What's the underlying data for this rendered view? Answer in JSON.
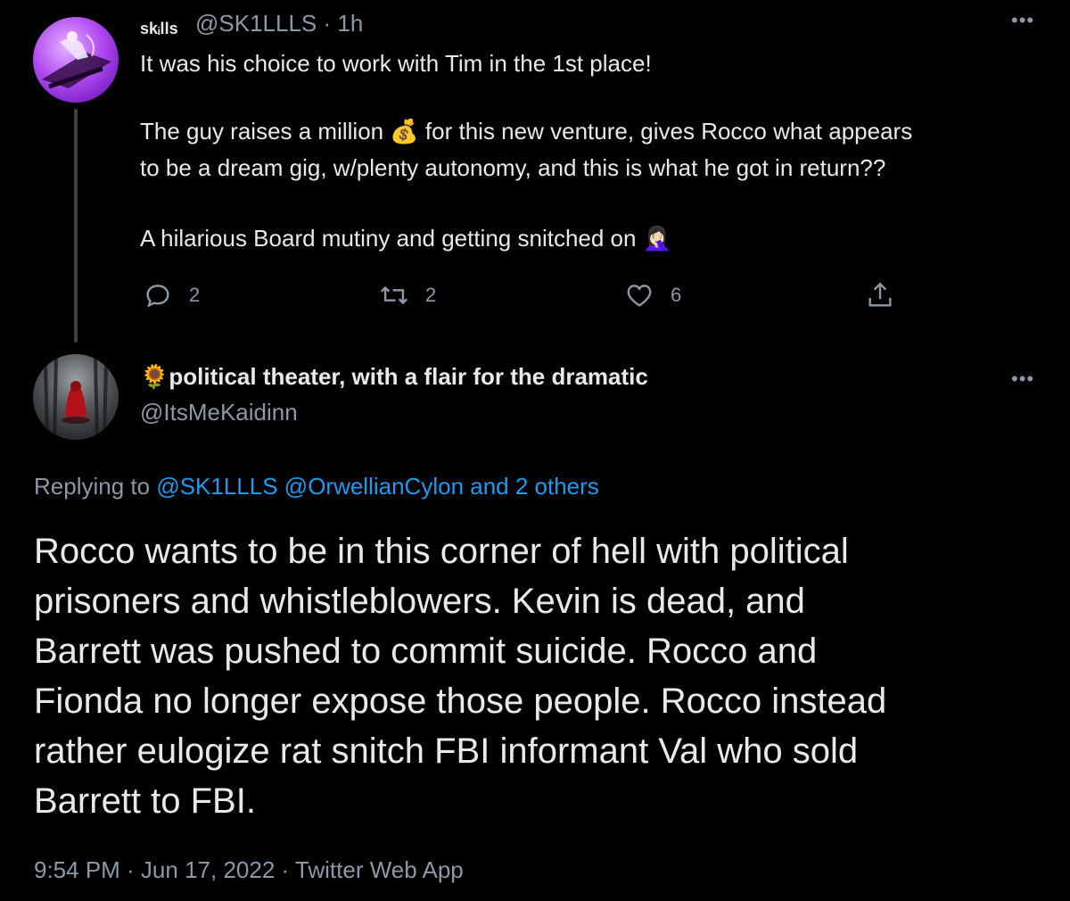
{
  "parent_tweet": {
    "display_name": "skᵢlls",
    "handle": "@SK1LLLS",
    "time": "· 1h",
    "more_icon": "ellipsis-icon",
    "lines": [
      "It was his choice to work with Tim in the 1st place!",
      "",
      "The guy raises a million 💰 for this new venture, gives Rocco what appears",
      "to be a dream gig, w/plenty autonomy, and this is what he got in return??",
      "",
      "A hilarious Board mutiny and getting snitched on 🤦🏻‍♀️"
    ],
    "actions": {
      "reply_count": "2",
      "retweet_count": "2",
      "like_count": "6"
    }
  },
  "main_tweet": {
    "display_name": "🌻political theater, with a flair for the dramatic",
    "handle": "@ItsMeKaidinn",
    "replying_prefix": "Replying to",
    "replying_links": "@SK1LLLS @OrwellianCylon and 2 others",
    "body_lines": [
      "Rocco wants to be in this corner of hell with political",
      "prisoners and whistleblowers.  Kevin is dead, and",
      "Barrett was pushed to commit suicide.  Rocco and",
      "Fionda no longer expose those people.  Rocco instead",
      "rather eulogize rat snitch FBI informant Val who sold",
      "Barrett to FBI."
    ],
    "timestamp": "9:54 PM · Jun 17, 2022 · Twitter Web App"
  },
  "colors": {
    "background": "#000000",
    "text": "#e7e9ea",
    "secondary": "#8b98a5",
    "link": "#1d9bf0",
    "thread_line": "#3e4144"
  }
}
